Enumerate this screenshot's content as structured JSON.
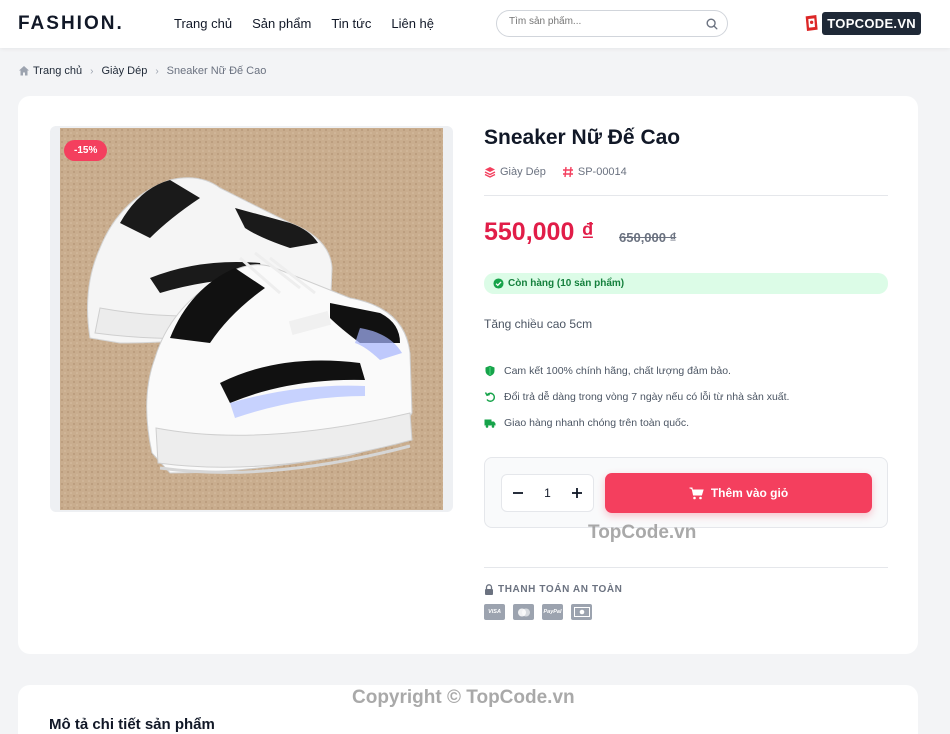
{
  "header": {
    "logo": "FASHION.",
    "nav": [
      "Trang chủ",
      "Sản phẩm",
      "Tin tức",
      "Liên hệ"
    ],
    "search_placeholder": "Tìm sản phẩm...",
    "brand_mark": "TOPCODE.VN"
  },
  "breadcrumb": {
    "home": "Trang chủ",
    "category": "Giày Dép",
    "current": "Sneaker Nữ Đế Cao"
  },
  "product": {
    "discount_badge": "-15%",
    "title": "Sneaker Nữ Đế Cao",
    "category": "Giày Dép",
    "sku": "SP-00014",
    "price": "550,000 ₫",
    "old_price": "650,000 ₫",
    "stock": "Còn hàng (10 sản phẩm)",
    "short_description": "Tăng chiều cao 5cm",
    "features": [
      "Cam kết 100% chính hãng, chất lượng đảm bảo.",
      "Đổi trả dễ dàng trong vòng 7 ngày nếu có lỗi từ nhà sản xuất.",
      "Giao hàng nhanh chóng trên toàn quốc."
    ],
    "quantity": "1",
    "add_to_cart": "Thêm vào giỏ",
    "secure_label": "THANH TOÁN AN TOÀN",
    "payments": [
      "VISA",
      "MC",
      "PayPal",
      "CASH"
    ]
  },
  "details": {
    "title": "Mô tả chi tiết sản phẩm"
  },
  "watermarks": {
    "center": "TopCode.vn",
    "copyright": "Copyright © TopCode.vn"
  },
  "colors": {
    "accent": "#f43f5e",
    "price": "#e11d48",
    "stock_bg": "#dcfce7",
    "stock_text": "#15803d"
  }
}
